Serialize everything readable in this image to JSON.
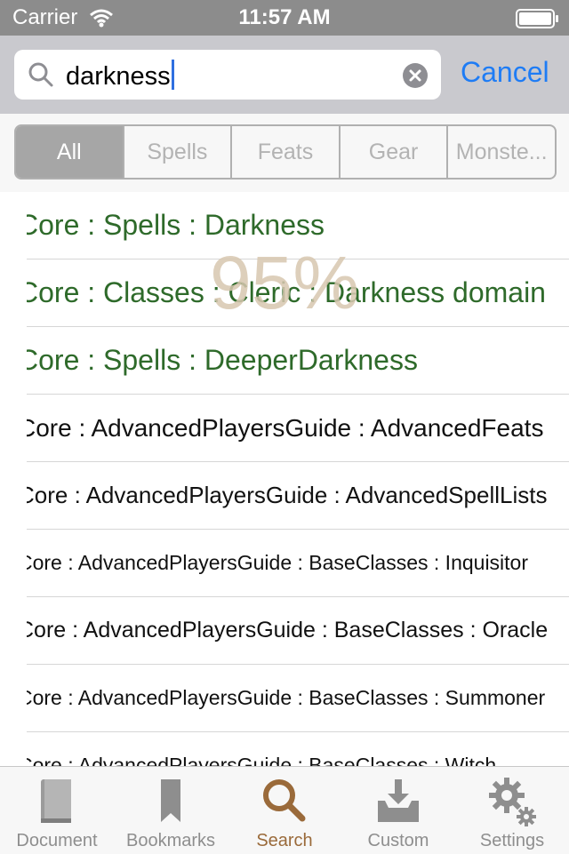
{
  "status_bar": {
    "carrier": "Carrier",
    "time": "11:57 AM"
  },
  "search": {
    "value": "darkness",
    "cancel_label": "Cancel"
  },
  "filter": {
    "segments": [
      "All",
      "Spells",
      "Feats",
      "Gear",
      "Monste..."
    ],
    "selected": "All"
  },
  "results": [
    {
      "text": "Core : Spells : Darkness",
      "style": "primary"
    },
    {
      "text": "Core : Classes : Cleric : Darkness domain",
      "style": "primary"
    },
    {
      "text": "Core : Spells : DeeperDarkness",
      "style": "primary"
    },
    {
      "text": "Core : AdvancedPlayersGuide : AdvancedFeats",
      "style": "secondary"
    },
    {
      "text": "Core : AdvancedPlayersGuide : AdvancedSpellLists",
      "style": "secondary"
    },
    {
      "text": "Core : AdvancedPlayersGuide : BaseClasses : Inquisitor",
      "style": "secondary"
    },
    {
      "text": "Core : AdvancedPlayersGuide : BaseClasses : Oracle",
      "style": "secondary"
    },
    {
      "text": "Core : AdvancedPlayersGuide : BaseClasses : Summoner",
      "style": "secondary"
    },
    {
      "text": "Core : AdvancedPlayersGuide : BaseClasses : Witch",
      "style": "secondary"
    }
  ],
  "progress_overlay": "95%",
  "tab_bar": {
    "tabs": [
      {
        "label": "Document",
        "icon": "book-icon"
      },
      {
        "label": "Bookmarks",
        "icon": "bookmark-icon"
      },
      {
        "label": "Search",
        "icon": "search-icon"
      },
      {
        "label": "Custom",
        "icon": "inbox-download-icon"
      },
      {
        "label": "Settings",
        "icon": "gear-icon"
      }
    ],
    "active": "Search"
  },
  "colors": {
    "accent_blue": "#1e7cf5",
    "primary_result": "#2e6a2a",
    "active_tab": "#9a6a3a",
    "inactive_tab": "#8e8e8e"
  }
}
